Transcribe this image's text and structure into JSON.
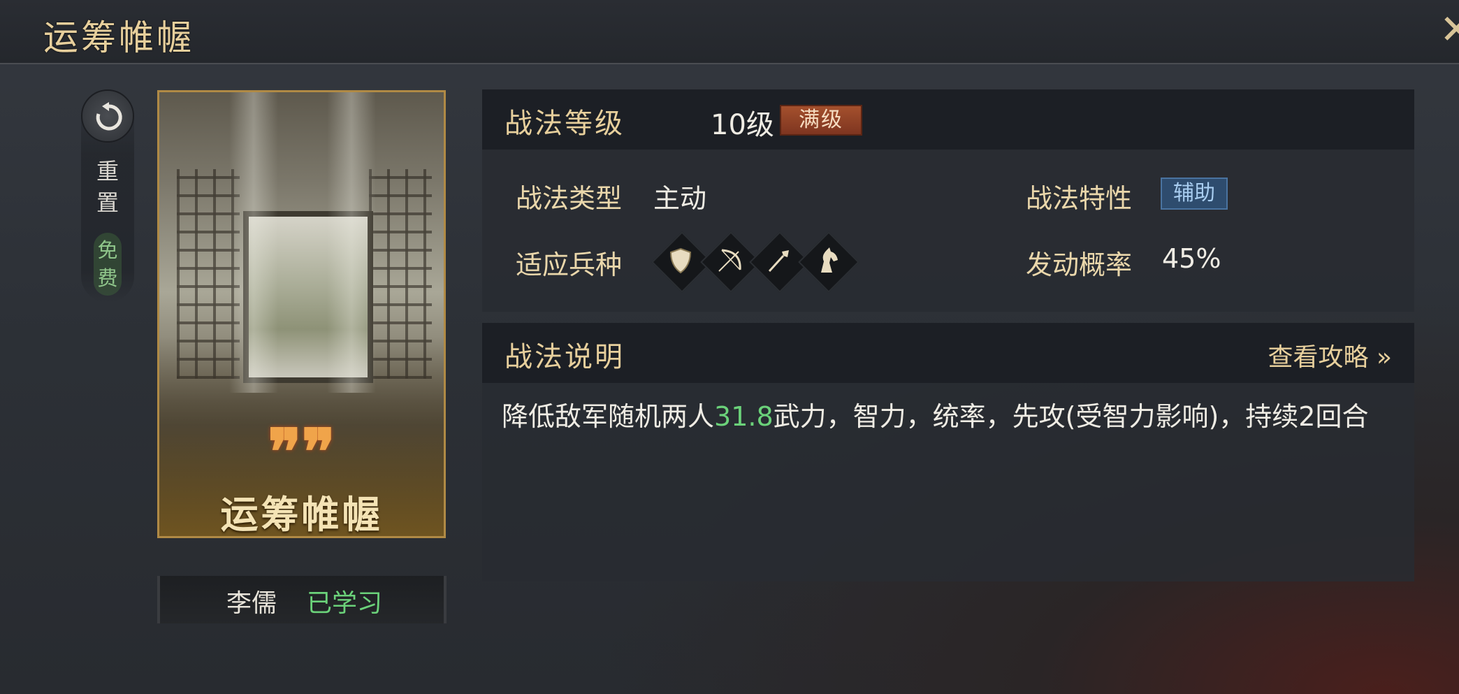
{
  "window": {
    "title": "运筹帷幄"
  },
  "reset": {
    "label_line1": "重",
    "label_line2": "置",
    "free_line1": "免",
    "free_line2": "费"
  },
  "card": {
    "name": "运筹帷幄",
    "quote_mark": "❞"
  },
  "owner": {
    "general": "李儒",
    "status": "已学习"
  },
  "level_panel": {
    "title": "战法等级",
    "level": "10级",
    "max_tag": "满级",
    "type_label": "战法类型",
    "type_value": "主动",
    "trait_label": "战法特性",
    "trait_value": "辅助",
    "units_label": "适应兵种",
    "units": [
      "shield-icon",
      "bow-icon",
      "spear-icon",
      "horse-icon"
    ],
    "chance_label": "发动概率",
    "chance_value": "45%"
  },
  "desc_panel": {
    "title": "战法说明",
    "guide_link": "查看攻略 »",
    "text_before": "降低敌军随机两人",
    "text_highlight": "31.8",
    "text_after": "武力，智力，统率，先攻(受智力影响)，持续2回合"
  },
  "colors": {
    "gold": "#e7cf9c",
    "highlight": "#6bd27a",
    "max_tag": "#a4502d",
    "trait_tag": "#2e4c6e"
  }
}
